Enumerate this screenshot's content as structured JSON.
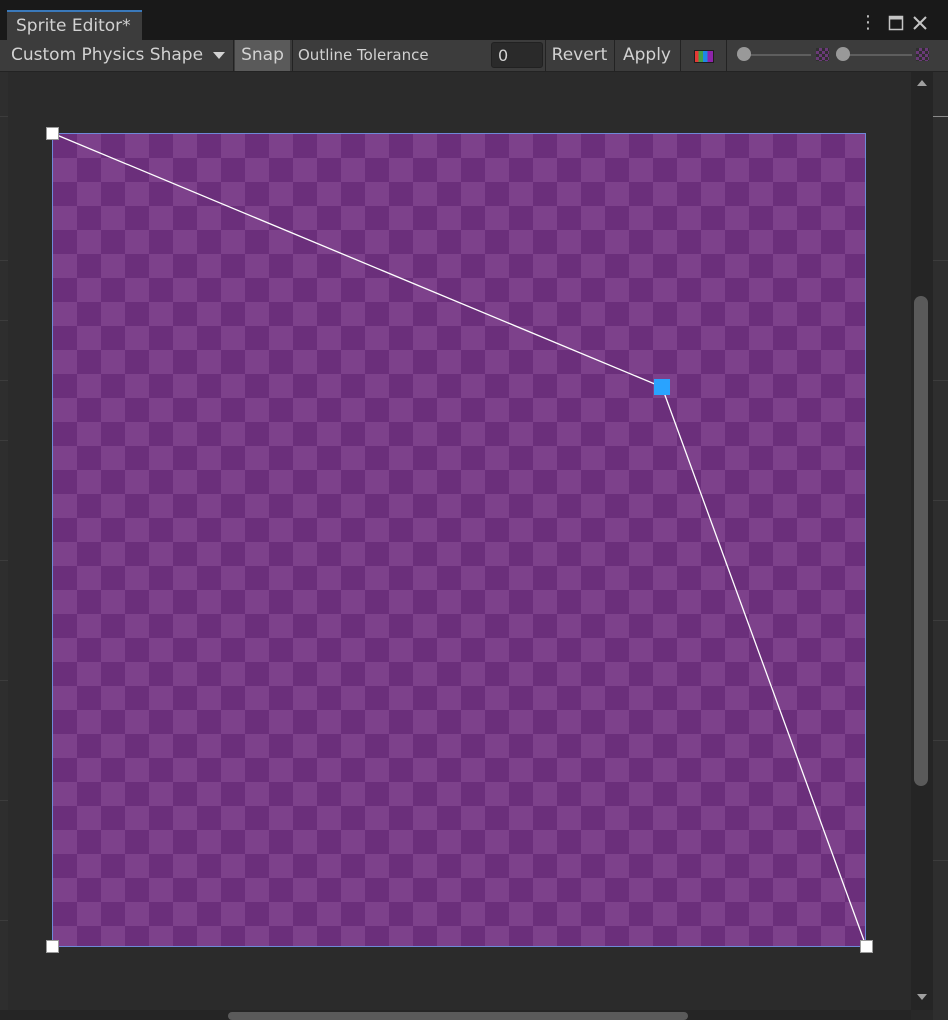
{
  "window": {
    "tab_title": "Sprite Editor*",
    "menu_icon": "kebab-menu-icon",
    "maximize_icon": "maximize-icon",
    "close_icon": "close-icon"
  },
  "toolbar": {
    "mode_label": "Custom Physics Shape",
    "snap_label": "Snap",
    "outline_tolerance_label": "Outline Tolerance",
    "outline_tolerance_value": "0",
    "revert_label": "Revert",
    "apply_label": "Apply",
    "color_channel_icon": "rgb-color-icon",
    "zoom_slider_value": 0.0,
    "mip_slider_value": 0.0,
    "zoom_icon": "checker-small-icon",
    "mip_icon": "checker-large-icon"
  },
  "canvas": {
    "sprite_background": "#6b2f7b",
    "sprite_checker": "#7d418b",
    "outline_color": "#ffffff",
    "selected_handle_color": "#29a3ff"
  }
}
